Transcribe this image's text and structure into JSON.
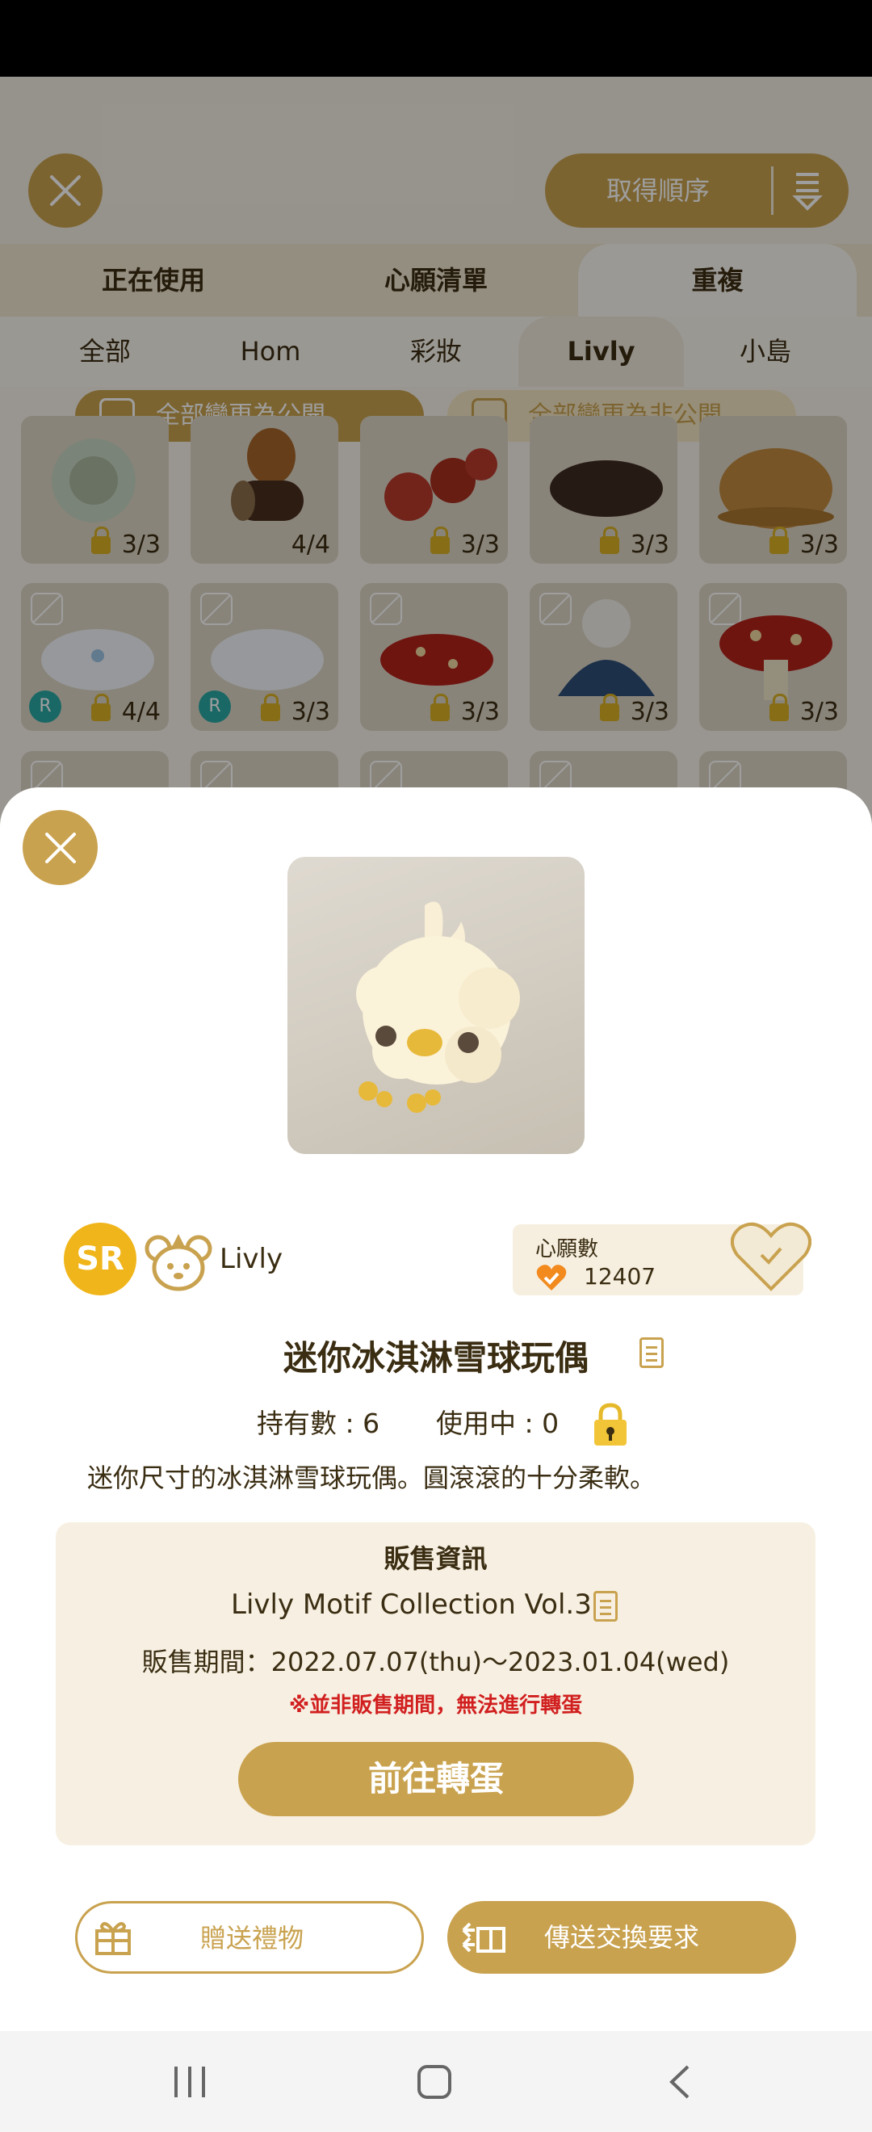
{
  "app": {
    "sort_label": "取得順序",
    "tabs_main": [
      "正在使用",
      "心願清單",
      "重複"
    ],
    "tabs_category": [
      "全部",
      "Hom",
      "彩妝",
      "Livly",
      "小島"
    ],
    "set_public_label": "全部變更為公開",
    "set_private_label": "全部變更為非公開",
    "items": [
      {
        "count": "3/3",
        "rare": ""
      },
      {
        "count": "4/4",
        "rare": ""
      },
      {
        "count": "3/3",
        "rare": ""
      },
      {
        "count": "3/3",
        "rare": ""
      },
      {
        "count": "3/3",
        "rare": ""
      },
      {
        "count": "4/4",
        "rare": "R"
      },
      {
        "count": "3/3",
        "rare": "R"
      },
      {
        "count": "3/3",
        "rare": ""
      },
      {
        "count": "3/3",
        "rare": ""
      },
      {
        "count": "3/3",
        "rare": ""
      }
    ]
  },
  "detail": {
    "rarity": "SR",
    "category_label": "Livly",
    "wish_label": "心願數",
    "wish_count": "12407",
    "item_name": "迷你冰淇淋雪球玩偶",
    "owned_label": "持有數 : 6",
    "in_use_label": "使用中 : 0",
    "description": "迷你尺寸的冰淇淋雪球玩偶。圓滾滾的十分柔軟。",
    "sale": {
      "title": "販售資訊",
      "collection": "Livly Motif Collection Vol.3",
      "period": "販售期間：2022.07.07(thu)～2023.01.04(wed)",
      "warning": "※並非販售期間，無法進行轉蛋",
      "gacha_button": "前往轉蛋"
    },
    "gift_button": "贈送禮物",
    "trade_button": "傳送交換要求"
  },
  "colors": {
    "accent": "#c9a24f",
    "sr_badge": "#f0b51a",
    "warning": "#d11f1f",
    "text": "#3a2d12"
  }
}
